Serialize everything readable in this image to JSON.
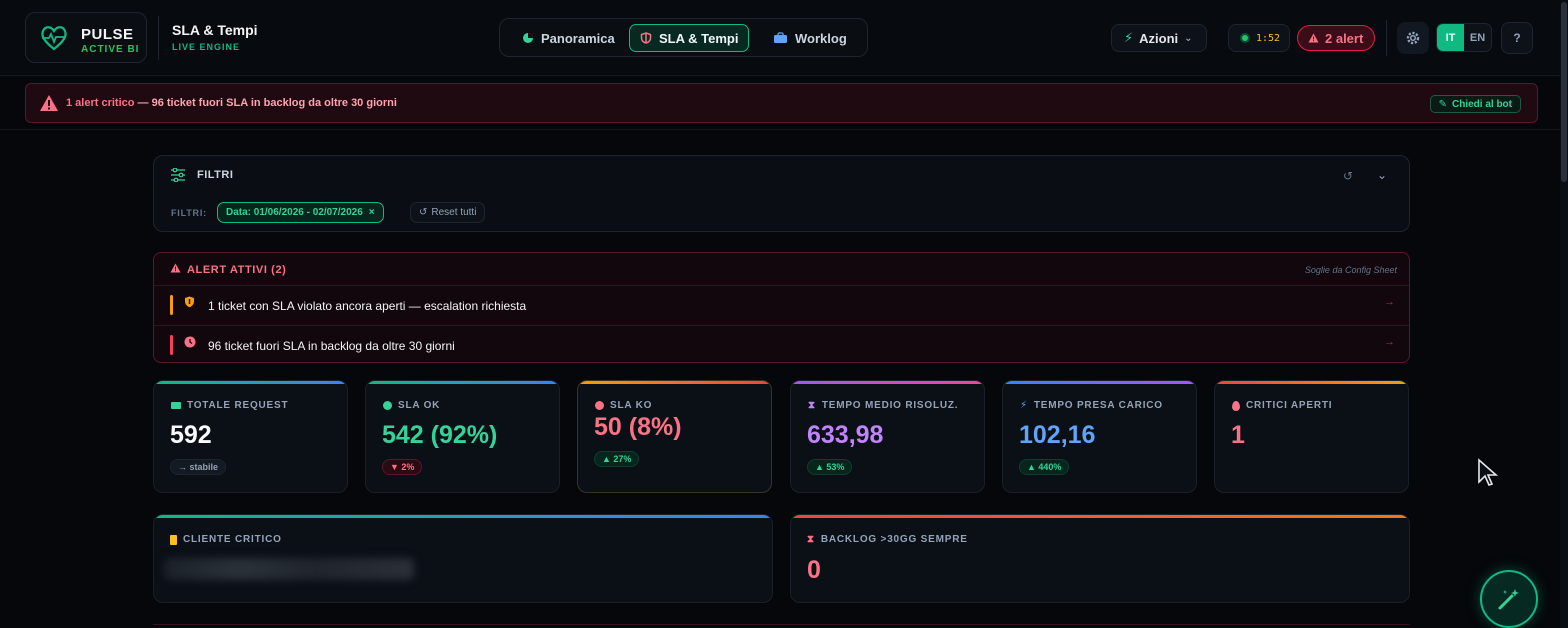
{
  "brand": {
    "name": "PULSE",
    "subtitle": "ACTIVE BI"
  },
  "page": {
    "title": "SLA & Tempi",
    "subtitle": "LIVE ENGINE"
  },
  "nav": {
    "tabs": [
      {
        "label": "Panoramica",
        "icon": "pie-chart-icon",
        "active": false
      },
      {
        "label": "SLA & Tempi",
        "icon": "shield-icon",
        "active": true
      },
      {
        "label": "Worklog",
        "icon": "briefcase-icon",
        "active": false
      }
    ]
  },
  "header": {
    "actions_label": "Azioni",
    "timer": "1:52",
    "alert_label": "2 alert",
    "lang": {
      "it": "IT",
      "en": "EN"
    },
    "help": "?"
  },
  "banner": {
    "prefix": "1 alert critico",
    "text": " — 96 ticket fuori SLA in backlog da oltre 30 giorni",
    "bot_label": "Chiedi al bot"
  },
  "filters": {
    "title": "FILTRI",
    "label": "FILTRI:",
    "date_chip": "Data: 01/06/2026 - 02/07/2026",
    "reset_label": "Reset tutti"
  },
  "alerts": {
    "title": "ALERT ATTIVI (2)",
    "source": "Soglie da Config Sheet",
    "items": [
      {
        "text": "1 ticket con SLA violato ancora aperti — escalation richiesta",
        "color": "#f59e0b"
      },
      {
        "text": "96 ticket fuori SLA in backlog da oltre 30 giorni",
        "color": "#f43f5e"
      }
    ]
  },
  "kpis": [
    {
      "label": "TOTALE REQUEST",
      "value": "592",
      "badge": "→ stabile",
      "badge_type": "gray",
      "value_color": "#f9fafb"
    },
    {
      "label": "SLA OK",
      "value": "542 (92%)",
      "badge": "▼ 2%",
      "badge_type": "red",
      "value_color": "#34d399"
    },
    {
      "label": "SLA KO",
      "value": "50 (8%)",
      "badge": "▲ 27%",
      "badge_type": "green",
      "value_color": "#fb7185"
    },
    {
      "label": "TEMPO MEDIO RISOLUZ.",
      "value": "633,98",
      "badge": "▲ 53%",
      "badge_type": "green",
      "value_color": "#c084fc"
    },
    {
      "label": "TEMPO PRESA CARICO",
      "value": "102,16",
      "badge": "▲ 440%",
      "badge_type": "green",
      "value_color": "#60a5fa"
    },
    {
      "label": "CRITICI APERTI",
      "value": "1",
      "badge": "",
      "badge_type": "",
      "value_color": "#fb7185"
    }
  ],
  "wide_cards": {
    "client": {
      "label": "CLIENTE CRITICO"
    },
    "backlog": {
      "label": "BACKLOG >30GG SEMPRE",
      "value": "0"
    }
  },
  "colors": {
    "accent": "#10b981",
    "danger": "#f43f5e",
    "warning": "#f59e0b"
  }
}
